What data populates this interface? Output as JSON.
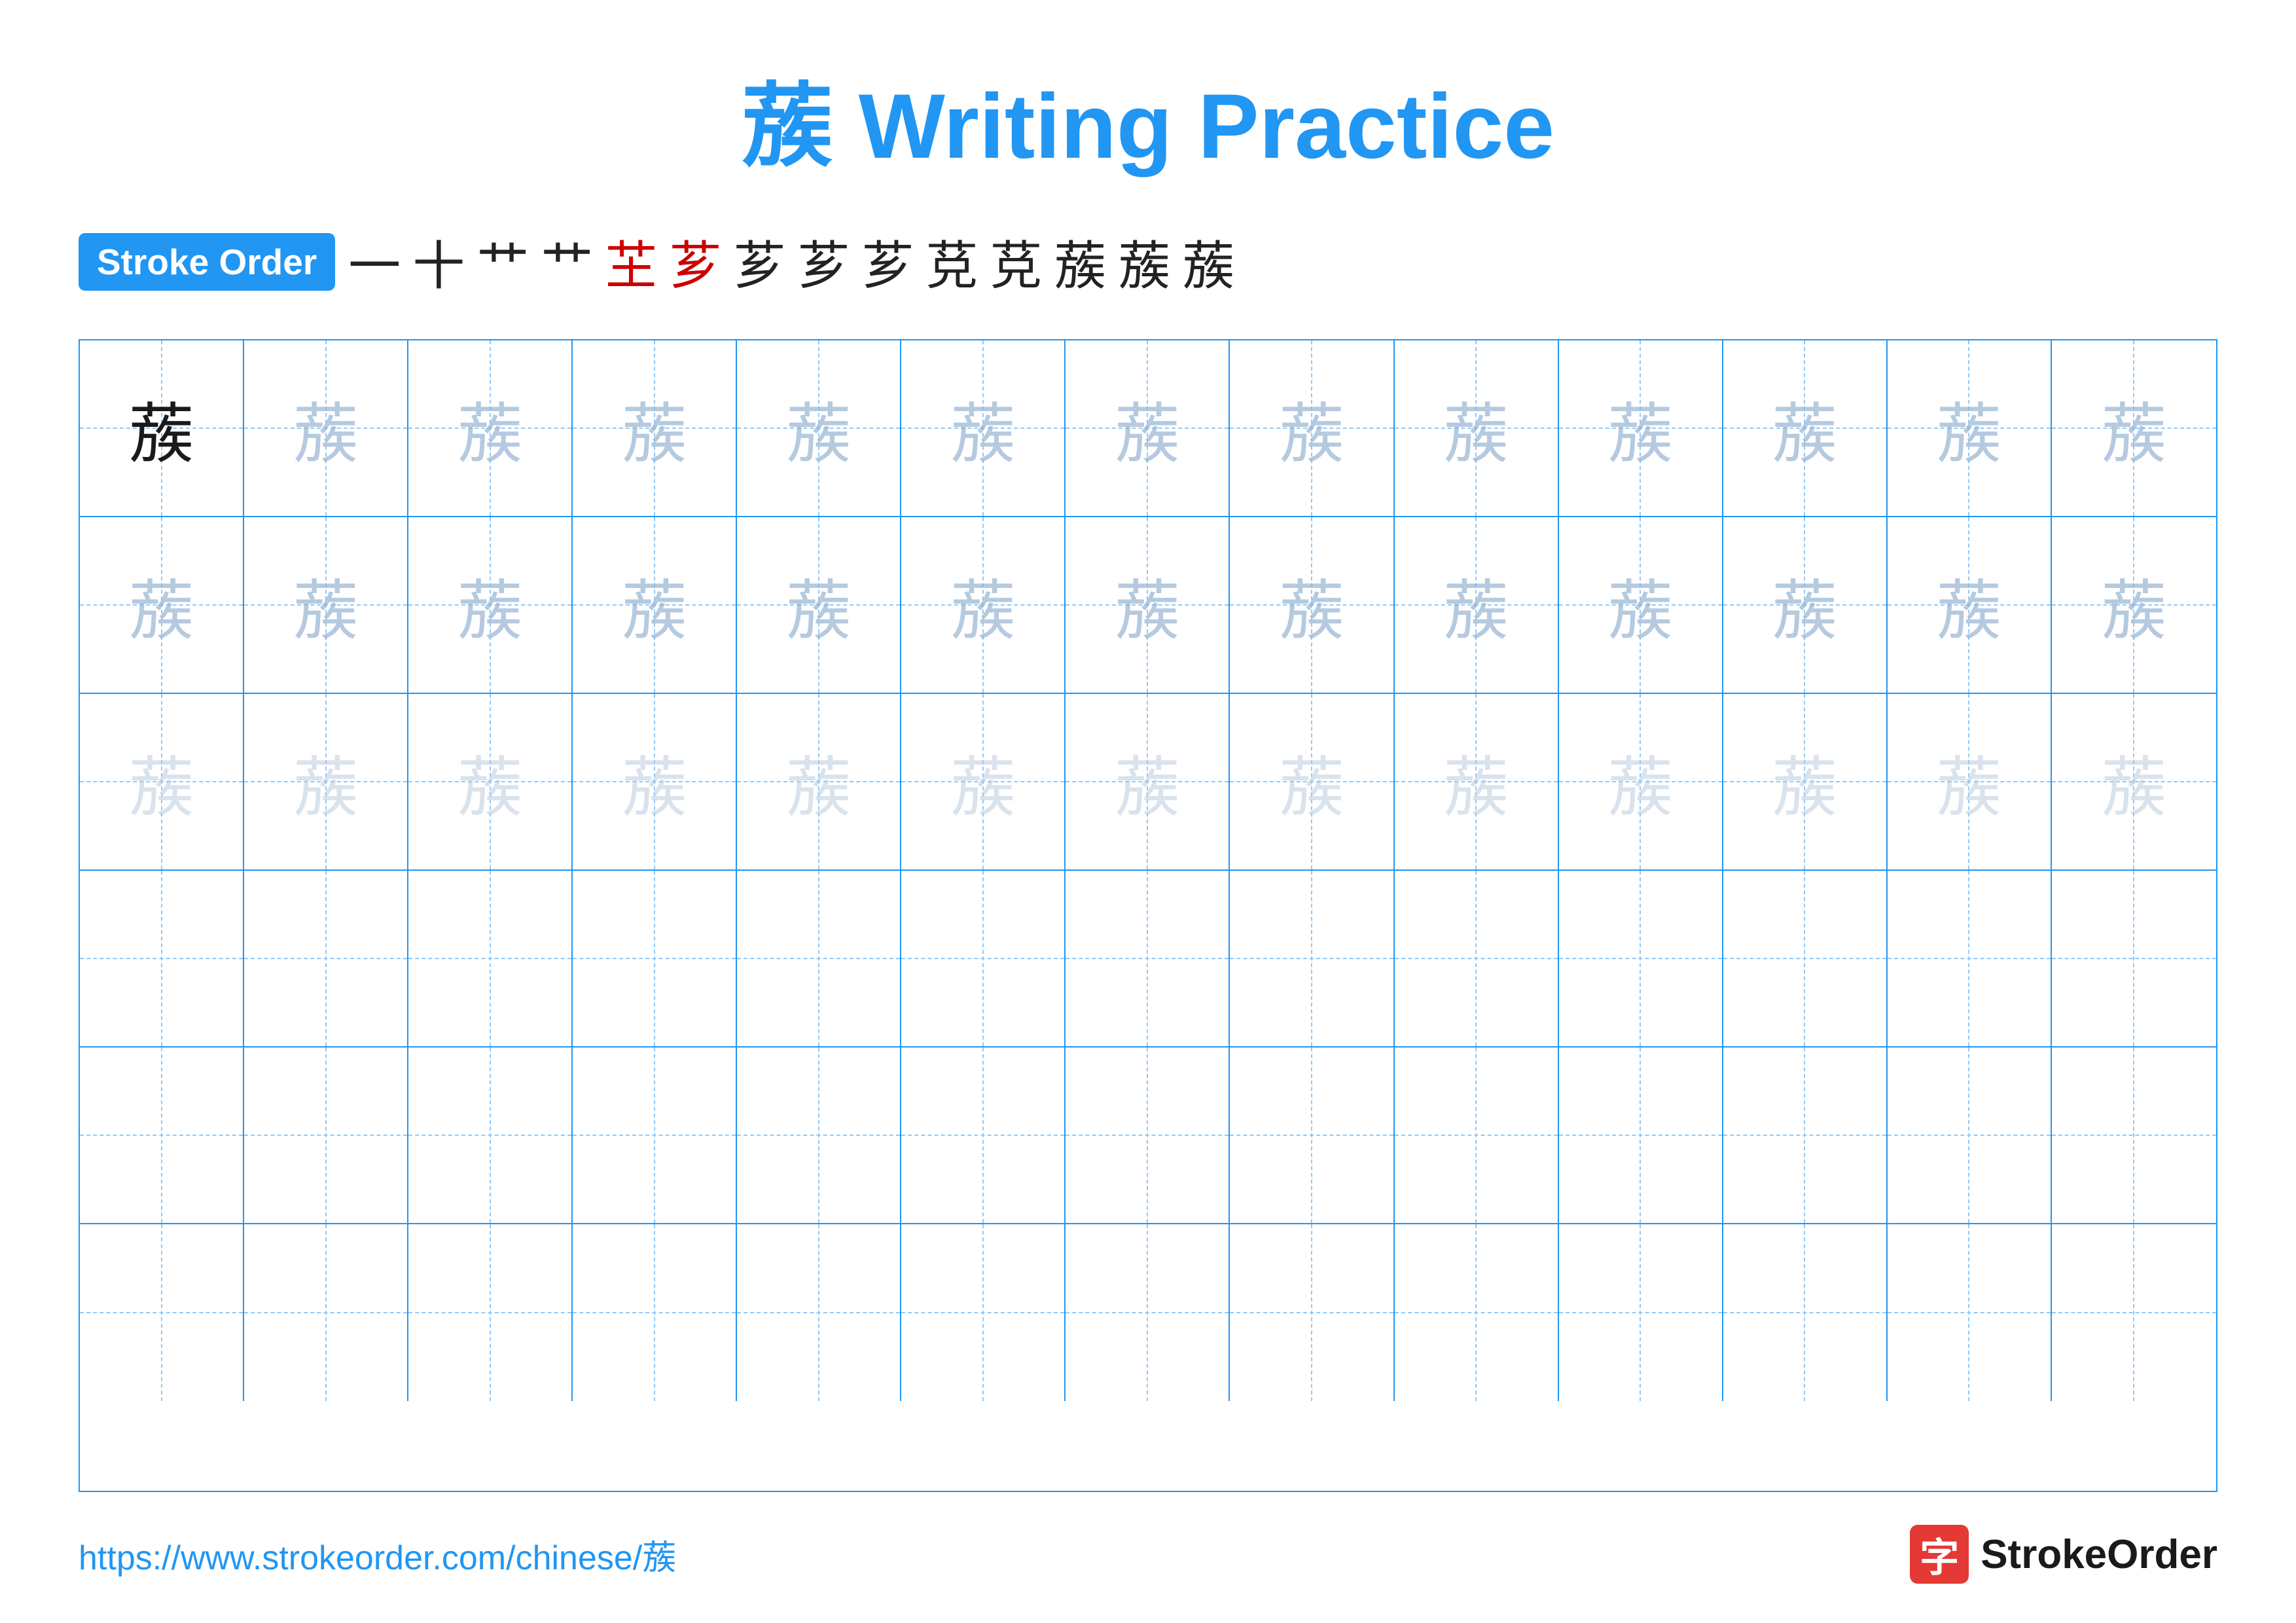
{
  "title": "蔟 Writing Practice",
  "stroke_order_label": "Stroke Order",
  "stroke_sequence": [
    "一",
    "十",
    "艹",
    "艹",
    "芏",
    "芗",
    "芗",
    "芗",
    "芗",
    "莌",
    "莌",
    "蔟",
    "蔟",
    "蔟"
  ],
  "character": "蔟",
  "rows": [
    {
      "type": "solid_then_light1",
      "solid_count": 1,
      "light1_count": 12
    },
    {
      "type": "light1",
      "count": 13
    },
    {
      "type": "light2",
      "count": 13
    },
    {
      "type": "empty",
      "count": 13
    },
    {
      "type": "empty",
      "count": 13
    },
    {
      "type": "empty",
      "count": 13
    }
  ],
  "footer": {
    "url": "https://www.strokeorder.com/chinese/蔟",
    "logo_text": "StrokeOrder",
    "logo_icon": "字"
  }
}
